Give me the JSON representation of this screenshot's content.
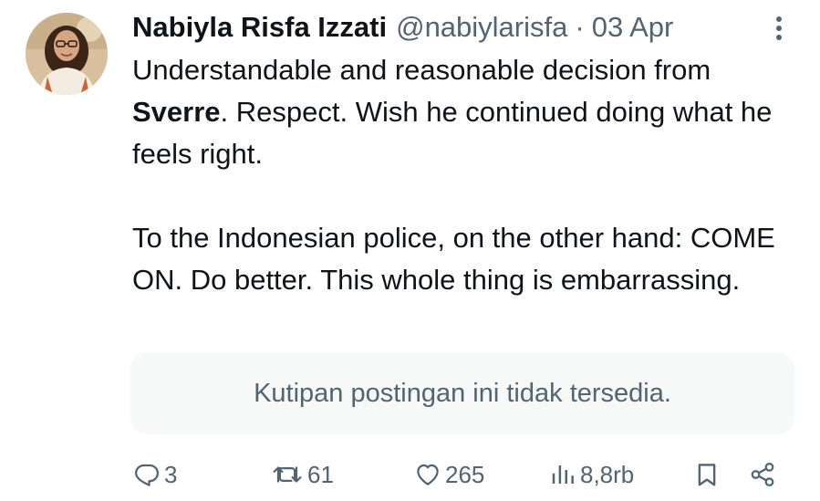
{
  "tweet": {
    "author": {
      "display_name": "Nabiyla Risfa Izzati",
      "handle": "@nabiylarisfa",
      "avatar_icon": "profile-photo"
    },
    "separator": "·",
    "date": "03 Apr",
    "more_icon": "more-vertical-icon",
    "text": {
      "p1_before": "Understandable and reasonable decision from ",
      "p1_mention": "Sverre",
      "p1_after": ". Respect. Wish he continued doing what he feels right.",
      "p2": "To the Indonesian police, on the other hand: COME ON. Do better. This whole thing is embarrassing."
    },
    "quote_unavailable": "Kutipan postingan ini tidak tersedia.",
    "actions": {
      "reply": {
        "icon": "reply-icon",
        "count": "3"
      },
      "repost": {
        "icon": "repost-icon",
        "count": "61"
      },
      "like": {
        "icon": "heart-icon",
        "count": "265"
      },
      "views": {
        "icon": "views-icon",
        "count": "8,8rb"
      },
      "bookmark": {
        "icon": "bookmark-icon"
      },
      "share": {
        "icon": "share-icon"
      }
    }
  },
  "colors": {
    "text_primary": "#0f1419",
    "text_secondary": "#536471",
    "quote_background": "#f7f9f9",
    "background": "#ffffff"
  }
}
